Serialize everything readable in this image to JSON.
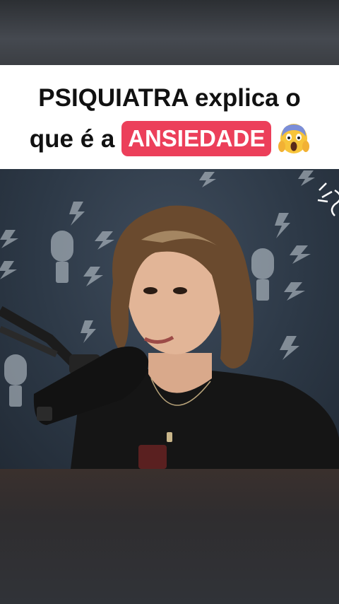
{
  "caption": {
    "line1": "PSIQUIATRA explica o",
    "line2_prefix": "que é a",
    "highlight": "ANSIEDADE"
  },
  "icons": {
    "emoji": "face-screaming-in-fear-icon",
    "wall_pattern": [
      "microphone-icon",
      "lightning-bolt-icon"
    ],
    "sparkle": "sparkle-icon"
  },
  "colors": {
    "banner_background": "#ffffff",
    "highlight_background": "#ec3f5a",
    "highlight_text": "#ffffff",
    "caption_text": "#111111",
    "video_background": "#2d3947"
  }
}
